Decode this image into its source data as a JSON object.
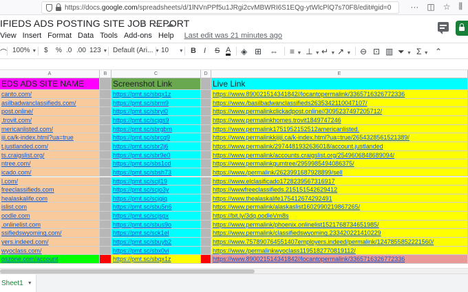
{
  "browser": {
    "url_prefix": "https://docs.",
    "url_host": "google.com",
    "url_path": "/spreadsheets/d/1lNVnPPf5u1JRgi2cvMBWRI6S1EQg-ytWlcPlQ7s70F8/edit#gid=0",
    "more_icon": "ellipsis-icon",
    "pocket_icon": "pocket-icon",
    "star_icon": "star-icon",
    "library_icon": "library-icon"
  },
  "doc": {
    "title": "IFIEDS ADS POSTING SITE JOB REPORT",
    "star_icon": "star-icon",
    "move_icon": "folder-icon",
    "cloud_icon": "cloud-icon"
  },
  "menu": {
    "items": [
      "View",
      "Insert",
      "Format",
      "Data",
      "Tools",
      "Add-ons",
      "Help"
    ],
    "last_edit": "Last edit was 21 minutes ago"
  },
  "toolbar": {
    "zoom": "100%",
    "currency": "$",
    "percent": "%",
    "decrease_decimal": ".0",
    "increase_decimal": ".00",
    "more_formats": "123",
    "font": "Default (Ari...",
    "font_size": "10",
    "bold": "B",
    "italic": "I",
    "strike": "S",
    "text_color": "A"
  },
  "grid": {
    "columns": [
      "A",
      "B",
      "C",
      "D",
      "E"
    ],
    "header": {
      "a": "EDS ADS SITE NAME",
      "b": "",
      "c": "Screenshot Link",
      "d": "",
      "e": "Live Link"
    },
    "rows": [
      {
        "a": "canto.com/",
        "c": "https://pmt.sc/sbqx1z",
        "e": "https://www.890021514341842//locantopermalink/3365716326772336"
      },
      {
        "a": "asilbadwanclassifieds.com/",
        "c": "https://pmt.sc/sbrm9",
        "e": "https://www./basilbadwanclassifieds2635342110047107/"
      },
      {
        "a": "post.online/",
        "c": "https://pmt.sc/sbryi0",
        "e": "https://www.permalinkclickadpost.online//3095237497205712/"
      },
      {
        "a": ".trovit.com/",
        "c": "https://pmt.sc/scjgs9",
        "e": "https://www.permalinkhomes.trovit1849747246"
      },
      {
        "a": "mericanlisted.com/",
        "c": "https://pmt.sc/sbrgbm",
        "e": "https://www.permalink1751952152512americanlisted."
      },
      {
        "a": "iji.ca/k-index.html?ua=true",
        "c": "https://pmt.sc/sbrcq9",
        "e": "https://www.permalinkkijiji.ca/k-index.html?ua=true/2654328561521389/"
      },
      {
        "a": "t.justlanded.com/",
        "c": "https://pmt.sc/sbr2j6",
        "e": "https://www.permalink/2974481932636018/account.justlanded"
      },
      {
        "a": "ts.craigslist.org/",
        "c": "https://pmt.sc/sbr9e0",
        "e": "https://www.permalink/accounts.craigslist.org/2549606848689094/"
      },
      {
        "a": "ntree.com/",
        "c": "https://pmt.sc/sbs1cd",
        "e": "https://www.permalinkgumtree/2959985494086375/"
      },
      {
        "a": "icado.com/",
        "c": "https://pmt.sc/sbsh73",
        "e": "https://www./permalink/2623991687928899/sell"
      },
      {
        "a": "l.com/",
        "c": "https://pmt.sc/scjl19",
        "e": "https://www.elclasificado1728239567316917"
      },
      {
        "a": "freeclassifieds.com",
        "c": "https://pmt.sc/scjo3y",
        "e": "https://wwwfreeclassifieds.215151542629412"
      },
      {
        "a": "healaskalife.com",
        "c": "https://pmt.sc/scjqiq",
        "e": "https://www.thealaskalife175412674292491"
      },
      {
        "a": "islist.com",
        "c": "https://pmt.sc/sbu5n6",
        "e": "https://www.permalink/alaskaslist1602990219867265/"
      },
      {
        "a": "oodle.com",
        "c": "https://pmt.sc/scjsgx",
        "e": "https://bit.ly/3dq.oodleVm8s"
      },
      {
        "a": ".onlinelist.com",
        "c": "https://pmt.sc/sbus9o",
        "e": "https://www.permalink/phoenix.onlinelist1521768734651985/"
      },
      {
        "a": "ssifiedswyoming.com/",
        "c": "https://pmt.sc/sck1el",
        "e": "https://www.permalink/classifiedswyoming.233420221410229"
      },
      {
        "a": "yers.indeed.com/",
        "c": "https://pmt.sc/sbuyb2",
        "e": "https://www.757890764551407employers.indeed/permalink/1247855852221560/"
      },
      {
        "a": "wyoclass.com/",
        "c": "https://pmt.sc/sbx0vi",
        "e": "https://www./permalinkwyoclass1195182770819112/"
      },
      {
        "a": "oszone.com/account",
        "c": "https://pmt.sc/sbqx1z",
        "e": "https://www.890021514341842//locantopermalink/3365716326772336"
      }
    ]
  },
  "sheets": {
    "tabs": [
      "Sheet1"
    ]
  }
}
